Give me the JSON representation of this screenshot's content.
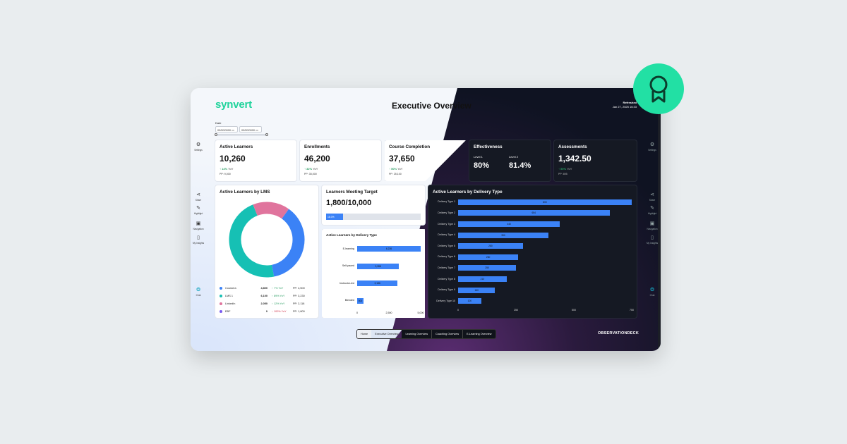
{
  "app": {
    "logo": "synvert",
    "title": "Executive Overview",
    "refreshed_label": "Refreshed",
    "refreshed_time": "Jan 27, 2025 16:33"
  },
  "filters": {
    "date_label": "Date",
    "start": "00/00/0000",
    "end": "00/00/0000"
  },
  "rail": [
    {
      "label": "Settings",
      "icon": "gear-icon"
    },
    {
      "label": "Share",
      "icon": "share-icon"
    },
    {
      "label": "Highlight",
      "icon": "highlight-icon"
    },
    {
      "label": "Navigation",
      "icon": "navigation-icon"
    },
    {
      "label": "My Insights",
      "icon": "bookmark-icon"
    },
    {
      "label": "Chat",
      "icon": "chat-icon"
    }
  ],
  "kpis": [
    {
      "title": "Active Learners",
      "value": "10,260",
      "yoy": "14%",
      "yoy_suffix": "YoY",
      "pp": "PP: 9,000"
    },
    {
      "title": "Enrollments",
      "value": "46,200",
      "yoy": "32%",
      "yoy_suffix": "YoY",
      "pp": "PP: 35,000"
    },
    {
      "title": "Course Completion",
      "value": "37,650",
      "yoy": "50%",
      "yoy_suffix": "YoY",
      "pp": "PP: 25,100"
    },
    {
      "title": "Effectiveness",
      "level1_label": "Level 1",
      "level1": "80%",
      "level2_label": "Level 2",
      "level2": "81.4%"
    },
    {
      "title": "Assessments",
      "value": "1,342.50",
      "yoy": "50%",
      "yoy_suffix": "YoY",
      "pp": "PP: 895"
    }
  ],
  "lms": {
    "title": "Active Learners by LMS",
    "rows": [
      {
        "name": "Coursera",
        "value": "4,800",
        "yoy": "7% YoY",
        "pp": "PP: 4,500",
        "dir": "up",
        "color": "#3b82f6"
      },
      {
        "name": "LMS 1",
        "value": "6,100",
        "yoy": "89% YoY",
        "pp": "PP: 3,230",
        "dir": "up",
        "color": "#16c0b4"
      },
      {
        "name": "LinkedIn",
        "value": "2,050",
        "yoy": "12% YoY",
        "pp": "PP: 2,118",
        "dir": "up",
        "color": "#e0749d"
      },
      {
        "name": "EBF",
        "value": "0",
        "yoy": "100% YoY",
        "pp": "PP: 1,800",
        "dir": "down",
        "color": "#7a5cf0"
      }
    ]
  },
  "target": {
    "title": "Learners Meeting Target",
    "value": "1,800/10,000",
    "progress": 18,
    "progress_label": "18.0%"
  },
  "colors": {
    "accent": "#3b82f6",
    "brand": "#1fd39b",
    "badge": "#22e0a4"
  },
  "chart_data": [
    {
      "type": "bar",
      "orientation": "horizontal",
      "title": "Active Learners by Delivery Type",
      "categories": [
        "E-learning",
        "Self-paced",
        "Instructor-led",
        "Blended"
      ],
      "values": [
        6226,
        3288,
        3186,
        500
      ],
      "value_labels": [
        "6,226",
        "3,288",
        "3,186",
        "500"
      ],
      "xticks": [
        "0",
        "2,500",
        "5,000"
      ],
      "xlim": [
        0,
        5000
      ]
    },
    {
      "type": "bar",
      "orientation": "horizontal",
      "title": "Active Learners by Delivery Type",
      "categories": [
        "Delivery Type 1",
        "Delivery Type 2",
        "Delivery Type 3",
        "Delivery Type 4",
        "Delivery Type 5",
        "Delivery Type 6",
        "Delivery Type 7",
        "Delivery Type 8",
        "Delivery Type 9",
        "Delivery Type 10"
      ],
      "values": [
        800,
        654,
        440,
        390,
        280,
        260,
        250,
        210,
        160,
        100
      ],
      "value_labels": [
        "800",
        "654",
        "440",
        "390",
        "280",
        "260",
        "250",
        "210",
        "160",
        "100"
      ],
      "xticks": [
        "0",
        "250",
        "500",
        "750"
      ],
      "xlim": [
        0,
        750
      ]
    }
  ],
  "nav": [
    "Home",
    "Executive Overview",
    "Learning Overview",
    "Coaching Overview",
    "E-Learning Overview"
  ],
  "brand_footer": "OBSERVATIONDECK"
}
